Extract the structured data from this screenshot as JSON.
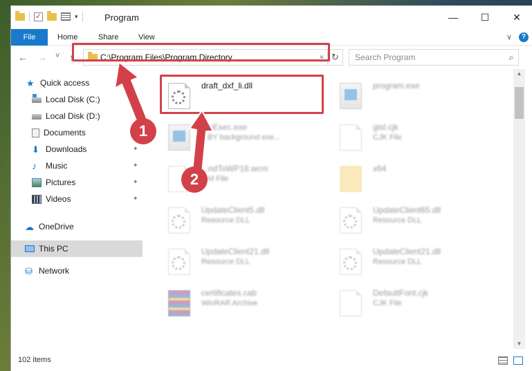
{
  "window": {
    "title": "Program",
    "controls": {
      "minimize": "—",
      "maximize": "☐",
      "close": "✕"
    }
  },
  "ribbon": {
    "tabs": [
      "File",
      "Home",
      "Share",
      "View"
    ],
    "chevron": "∨",
    "help": "?"
  },
  "nav": {
    "back": "←",
    "forward": "→",
    "recent": "˅",
    "up": "↑",
    "address": "C:\\Program Files\\Program Directory",
    "address_dropdown": "˅",
    "refresh": "↻",
    "search_placeholder": "Search Program",
    "search_icon": "⌕"
  },
  "sidebar": {
    "items": [
      {
        "label": "Quick access",
        "icon": "star-icon",
        "pinned": false
      },
      {
        "label": "Local Disk (C:)",
        "icon": "drive-c-icon",
        "pinned": false
      },
      {
        "label": "Local Disk (D:)",
        "icon": "drive-icon",
        "pinned": false
      },
      {
        "label": "Documents",
        "icon": "documents-icon",
        "pinned": false
      },
      {
        "label": "Downloads",
        "icon": "downloads-icon",
        "pinned": true
      },
      {
        "label": "Music",
        "icon": "music-icon",
        "pinned": true
      },
      {
        "label": "Pictures",
        "icon": "pictures-icon",
        "pinned": true
      },
      {
        "label": "Videos",
        "icon": "videos-icon",
        "pinned": true
      },
      {
        "label": "OneDrive",
        "icon": "onedrive-icon",
        "pinned": false
      },
      {
        "label": "This PC",
        "icon": "this-pc-icon",
        "pinned": false,
        "selected": true
      },
      {
        "label": "Network",
        "icon": "network-icon",
        "pinned": false
      }
    ],
    "pin_glyph": "📌"
  },
  "files": [
    {
      "name": "draft_dxf_li.dll",
      "type": "",
      "icon": "dll-file-icon",
      "highlighted": true
    },
    {
      "name": "program.exe",
      "type": "",
      "icon": "exe-file-icon"
    },
    {
      "name": "...eExec.exe",
      "type": "...BY background exe...",
      "icon": "exe-file-icon"
    },
    {
      "name": "gtsl.cjk",
      "type": "CJK File",
      "icon": "generic-file-icon"
    },
    {
      "name": "...ndToWP16.wcm",
      "type": "...M File",
      "icon": "generic-file-icon"
    },
    {
      "name": "x64",
      "type": "",
      "icon": "folder-icon"
    },
    {
      "name": "UpdateClient5.dll",
      "type": "Resource DLL",
      "icon": "dll-file-icon"
    },
    {
      "name": "UpdateClient65.dll",
      "type": "Resource DLL",
      "icon": "dll-file-icon"
    },
    {
      "name": "UpdateClient21.dll",
      "type": "Resource DLL",
      "icon": "dll-file-icon"
    },
    {
      "name": "UpdateClient21.dll",
      "type": "Resource DLL",
      "icon": "dll-file-icon"
    },
    {
      "name": "certificates.cab",
      "type": "WinRAR Archive",
      "icon": "archive-file-icon"
    },
    {
      "name": "DefaultFont.cjk",
      "type": "CJK File",
      "icon": "generic-file-icon"
    }
  ],
  "status": {
    "item_count": "102 items"
  },
  "annotations": {
    "step1": "1",
    "step2": "2",
    "color": "#d2414a"
  },
  "colors": {
    "accent": "#1979ca",
    "highlight": "#d2414a"
  }
}
